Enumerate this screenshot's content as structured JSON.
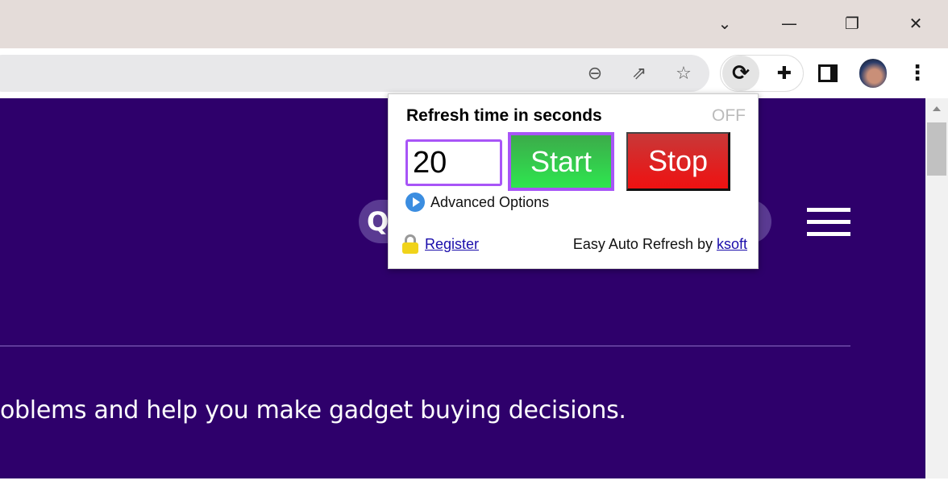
{
  "window": {
    "icons": [
      "chevron-down-icon",
      "minimize-icon",
      "restore-icon",
      "close-icon"
    ]
  },
  "toolbar": {
    "icons": [
      "zoom-out-icon",
      "share-icon",
      "star-icon",
      "refresh-extension-icon",
      "puzzle-icon",
      "side-panel-icon",
      "avatar",
      "more-icon"
    ]
  },
  "page": {
    "tagline": "oblems and help you make gadget buying decisions."
  },
  "popup": {
    "title": "Refresh time in seconds",
    "status": "OFF",
    "seconds_value": "20",
    "start_label": "Start",
    "stop_label": "Stop",
    "advanced_label": "Advanced Options",
    "register_label": "Register",
    "credit_text": "Easy Auto Refresh by ",
    "credit_link": "ksoft",
    "colors": {
      "start": "#2ee64f",
      "stop": "#ef1111",
      "highlight": "#a855f7",
      "status": "#bbbbbb"
    }
  }
}
